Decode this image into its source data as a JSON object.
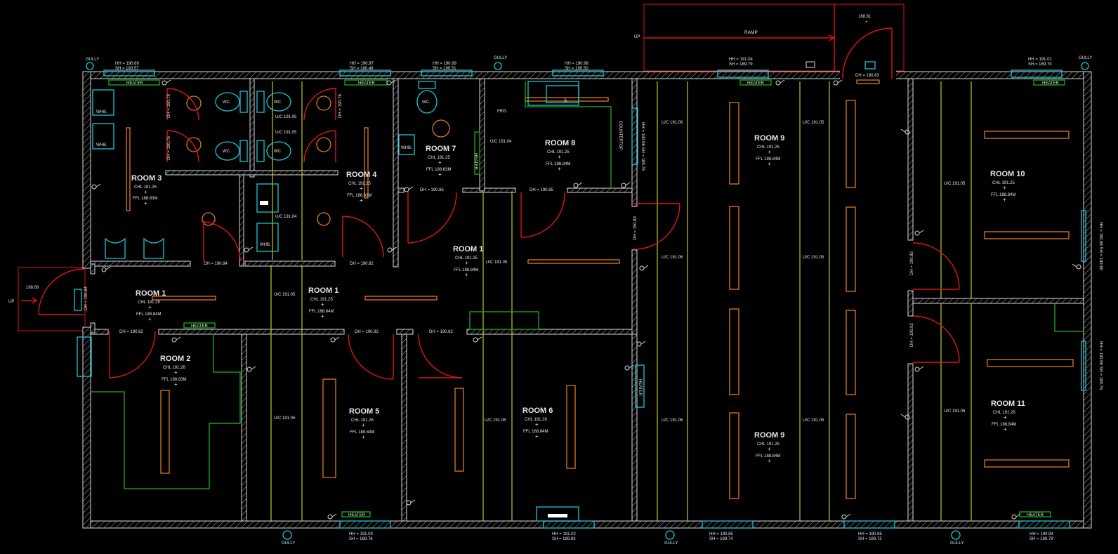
{
  "colors": {
    "background": "#000000",
    "walls": "#d8d8d8",
    "fixtures": "#19c7d8",
    "doors": "#e01515",
    "lights": "#e07a18",
    "grid": "#c8c81a",
    "furniture": "#1ab01a"
  },
  "ramp": {
    "label": "RAMP",
    "up": "UP",
    "level": "188.81"
  },
  "entrance": {
    "up": "UP",
    "level": "188.69"
  },
  "gully": "GULLY",
  "heater": "HEATER",
  "tops": [
    {
      "hh": "HH = 190.69",
      "sh": "SH = 190.57"
    },
    {
      "hh": "HH = 190.97",
      "sh": "SH = 190.48"
    },
    {
      "hh": "HH = 190.89",
      "sh": "SH = 190.51"
    },
    {
      "hh": "HH = 190.98",
      "sh": "SH = 190.50"
    },
    {
      "hh": "HH = 191.04",
      "sh": "SH = 189.79"
    },
    {
      "hh": "HH = 191.01",
      "sh": "SH = 189.70"
    }
  ],
  "bottoms": [
    {
      "hh": "HH = 191.03",
      "sh": "SH = 189.76"
    },
    {
      "hh": "HH = 191.02",
      "sh": "SH = 189.83"
    },
    {
      "hh": "HH = 190.85",
      "sh": "SH = 189.74"
    },
    {
      "hh": "HH = 190.85",
      "sh": "SH = 189.72"
    },
    {
      "hh": "HH = 190.94",
      "sh": "SH = 189.79"
    }
  ],
  "rooms": [
    {
      "name": "ROOM 3",
      "chl": "CHL 191.26",
      "ffl": "FFL 188.83M"
    },
    {
      "name": "ROOM 4",
      "chl": "CHL 191.25",
      "ffl": "FFL 188.83M"
    },
    {
      "name": "ROOM 7",
      "chl": "CHL 191.25",
      "ffl": "FFL 188.83M"
    },
    {
      "name": "ROOM 8",
      "chl": "CHL 191.25",
      "ffl": "FFL 188.84M"
    },
    {
      "name": "ROOM 9",
      "chl": "CHL 191.25",
      "ffl": "FFL 188.84M"
    },
    {
      "name": "ROOM 10",
      "chl": "CHL 191.25",
      "ffl": "FFL 188.84M"
    },
    {
      "name": "ROOM 1",
      "chl": "CHL 191.25",
      "ffl": "FFL 188.84M"
    },
    {
      "name": "ROOM 1",
      "chl": "CHL 191.25",
      "ffl": "FFL 188.84M"
    },
    {
      "name": "ROOM 1",
      "chl": "CHL 191.25",
      "ffl": "FFL 188.84M"
    },
    {
      "name": "ROOM 2",
      "chl": "CHL 191.26",
      "ffl": "FFL 188.83M"
    },
    {
      "name": "ROOM 5",
      "chl": "CHL 191.26",
      "ffl": "FFL 188.84M"
    },
    {
      "name": "ROOM 6",
      "chl": "CHL 191.26",
      "ffl": "FFL 188.84M"
    },
    {
      "name": "ROOM 9",
      "chl": "CHL 191.25",
      "ffl": "FFL 188.84M"
    },
    {
      "name": "ROOM 11",
      "chl": "CHL 191.26",
      "ffl": "FFL 188.84M"
    }
  ],
  "door_heads": [
    "DH = 190.84",
    "DH = 190.82",
    "DH = 190.85",
    "DH = 190.85",
    "DH = 190.82",
    "DH = 190.92",
    "DH = 190.82",
    "DH = 190.83",
    "DH = 190.84",
    "DH = 190.79",
    "DH = 190.76",
    "DH = 190.76",
    "DH = 190.83",
    "DH = 190.85",
    "DH = 190.92"
  ],
  "underside_ceilings": [
    "U/C 191.05",
    "U/C 191.05",
    "U/C 191.04",
    "U/C 191.04",
    "U/C 191.06",
    "U/C 191.05",
    "U/C 191.06",
    "U/C 191.05",
    "U/C 191.05",
    "U/C 191.05",
    "U/C 191.05",
    "U/C 191.06",
    "U/C 191.06",
    "U/C 191.05",
    "U/C 191.05",
    "U/C 191.06"
  ],
  "fixtures": {
    "wc": "WC.",
    "basin": "WHB.",
    "sink": "S.",
    "fridge": "FRG.",
    "counter": "COUNTERTOP",
    "heater_v": "HEATER"
  },
  "side_right": [
    {
      "text": "HH = 190.96  SH = 189.80"
    },
    {
      "text": "HH = 190.96  SH = 189.76"
    },
    {
      "text": "HH = 190.96  SH = 189.76"
    }
  ]
}
